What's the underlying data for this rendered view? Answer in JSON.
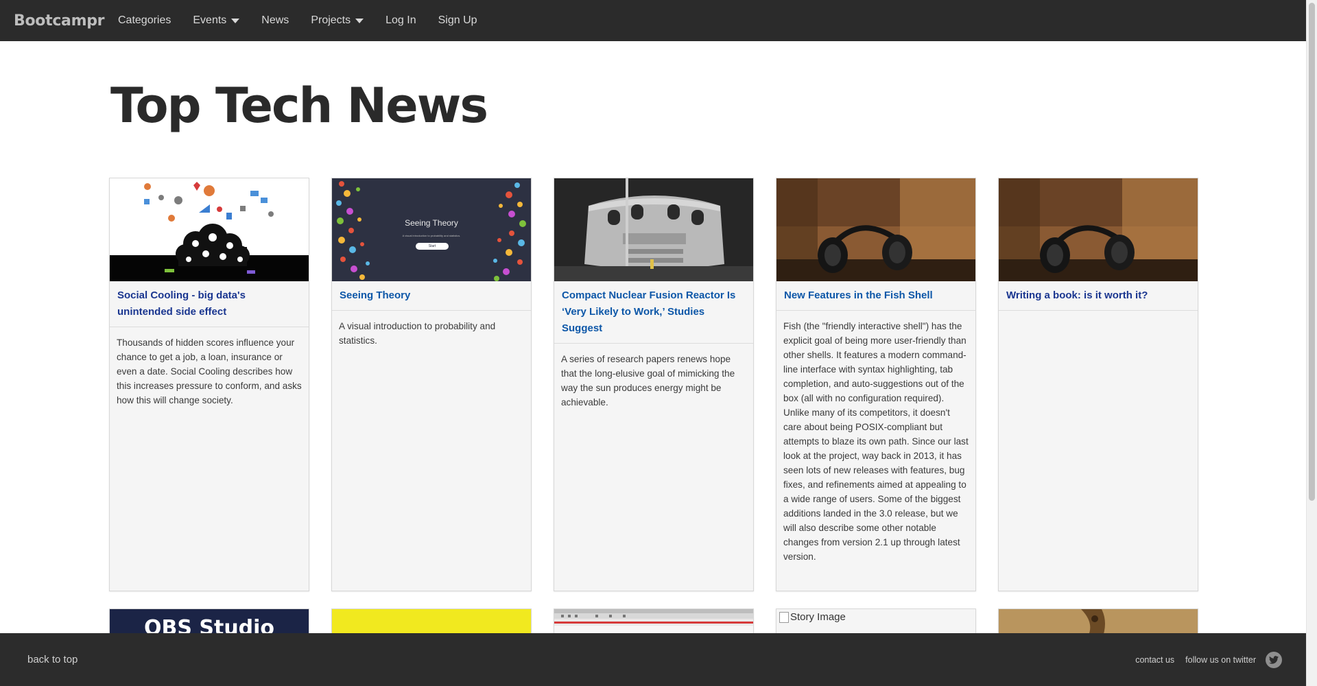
{
  "navbar": {
    "brand": "Bootcampr",
    "links": [
      {
        "label": "Categories",
        "dropdown": false
      },
      {
        "label": "Events",
        "dropdown": true
      },
      {
        "label": "News",
        "dropdown": false
      },
      {
        "label": "Projects",
        "dropdown": true
      },
      {
        "label": "Log In",
        "dropdown": false
      },
      {
        "label": "Sign Up",
        "dropdown": false
      }
    ]
  },
  "page": {
    "title": "Top Tech News"
  },
  "cards": [
    {
      "title": "Social Cooling - big data's unintended side effect",
      "description": "Thousands of hidden scores influence your chance to get a job, a loan, insurance or even a date. Social Cooling describes how this increases pressure to conform, and asks how this will change society.",
      "image": "cloud-gears-image"
    },
    {
      "title": "Seeing Theory",
      "description": "A visual introduction to probability and statistics.",
      "image": "seeing-theory-image",
      "image_text": "Seeing Theory",
      "image_subtext": "A visual introduction to probability and statistics.",
      "image_button": "Start"
    },
    {
      "title": "Compact Nuclear Fusion Reactor Is ‘Very Likely to Work,’ Studies Suggest",
      "description": "A series of research papers renews hope that the long-elusive goal of mimicking the way the sun produces energy might be achievable.",
      "image": "fusion-reactor-image"
    },
    {
      "title": "New Features in the Fish Shell",
      "description": "Fish (the \"friendly interactive shell\") has the explicit goal of being more user-friendly than other shells. It features a modern command-line interface with syntax highlighting, tab completion, and auto-suggestions out of the box (all with no configuration required). Unlike many of its competitors, it doesn't care about being POSIX-compliant but attempts to blaze its own path. Since our last look at the project, way back in 2013, it has seen lots of new releases with features, bug fixes, and refinements aimed at appealing to a wide range of users. Some of the biggest additions landed in the 3.0 release, but we will also describe some other notable changes from version 2.1 up through latest version.",
      "image": "headphones-image"
    },
    {
      "title": "Writing a book: is it worth it?",
      "description": "",
      "image": "headphones-image"
    }
  ],
  "second_row": {
    "obs_text": "OBS Studio",
    "story_image_alt": "Story Image"
  },
  "footer": {
    "back_to_top": "back to top",
    "contact": "contact us",
    "twitter": "follow us on twitter"
  },
  "colors": {
    "navbar": "#2b2b2b",
    "link": "#0d57a8",
    "footer": "#2c2c2c"
  }
}
